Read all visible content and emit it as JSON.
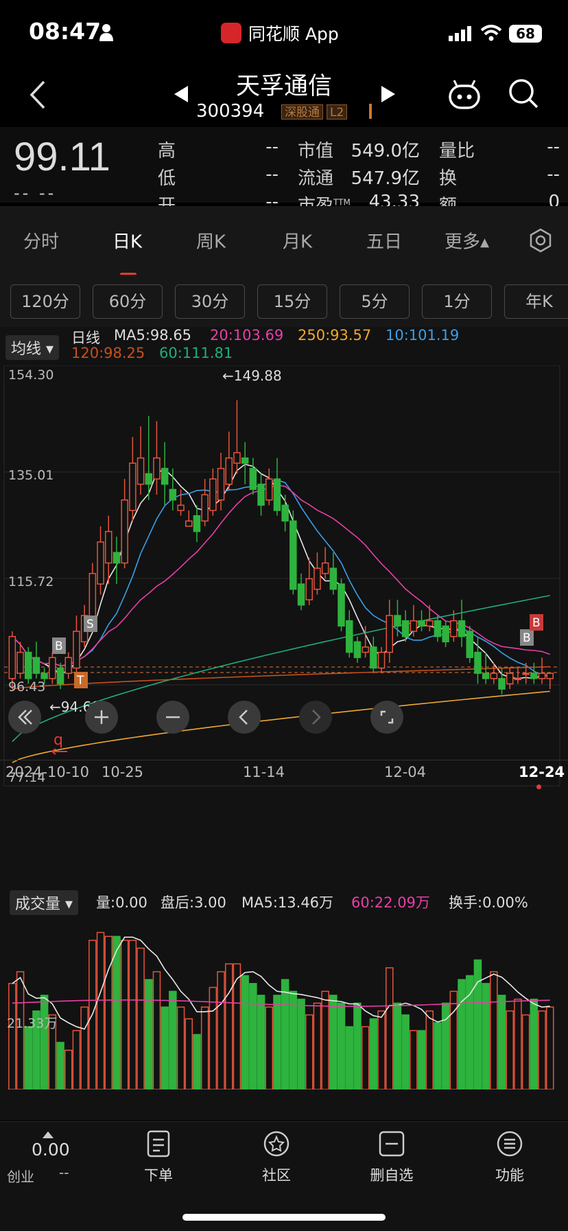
{
  "status_bar": {
    "time": "08:47",
    "app_name": "同花顺 App",
    "battery": "68"
  },
  "header": {
    "title": "天孚通信",
    "code": "300394",
    "tags": [
      "深股通",
      "L2"
    ]
  },
  "quote": {
    "price": "99.11",
    "change": "-- --",
    "fields": [
      {
        "label": "高",
        "value": "--"
      },
      {
        "label": "低",
        "value": "--"
      },
      {
        "label": "开",
        "value": "--"
      },
      {
        "label": "市值",
        "value": "549.0亿"
      },
      {
        "label": "流通",
        "value": "547.9亿"
      },
      {
        "label": "市盈",
        "sup": "TTM",
        "value": "43.33"
      },
      {
        "label": "量比",
        "value": "--"
      },
      {
        "label": "换",
        "value": "--"
      },
      {
        "label": "额",
        "value": "0"
      }
    ]
  },
  "tabs": [
    "分时",
    "日K",
    "周K",
    "月K",
    "五日",
    "更多▴"
  ],
  "active_tab": "日K",
  "periods": [
    "120分",
    "60分",
    "30分",
    "15分",
    "5分",
    "1分",
    "年K"
  ],
  "ma_legend": {
    "selector": "均线 ▾",
    "kind": "日线",
    "row1": [
      {
        "text": "MA5:98.65",
        "color": "#dddddd"
      },
      {
        "text": "20:103.69",
        "color": "#e83fa8"
      },
      {
        "text": "250:93.57",
        "color": "#f0a830"
      },
      {
        "text": "10:101.19",
        "color": "#3aa0e8"
      }
    ],
    "row2": [
      {
        "text": "120:98.25",
        "color": "#c8501a"
      },
      {
        "text": "60:111.81",
        "color": "#1fae7a"
      }
    ]
  },
  "chart_labels": {
    "y_ticks": [
      "154.30",
      "135.01",
      "115.72",
      "96.43",
      "77.14"
    ],
    "high_label": "←149.88",
    "low_label": "←94.60",
    "x_ticks": [
      "2024-10-10",
      "10-25",
      "11-14",
      "12-04",
      "12-24"
    ],
    "markers": [
      "B",
      "S",
      "T",
      "B",
      "B"
    ]
  },
  "volume_legend": {
    "selector": "成交量 ▾",
    "items": [
      {
        "text": "量:0.00",
        "color": "#dddddd"
      },
      {
        "text": "盘后:3.00",
        "color": "#dddddd"
      },
      {
        "text": "MA5:13.46万",
        "color": "#dddddd"
      },
      {
        "text": "60:22.09万",
        "color": "#e83fa8"
      },
      {
        "text": "换手:0.00%",
        "color": "#dddddd"
      }
    ],
    "y_label": "21.33万"
  },
  "chart_data": {
    "type": "candlestick",
    "ylim": [
      77.14,
      154.3
    ],
    "candles": [
      [
        96,
        104,
        94,
        105
      ],
      [
        97,
        101,
        96,
        103
      ],
      [
        101,
        96,
        95,
        102
      ],
      [
        100,
        97,
        96,
        103
      ],
      [
        97,
        96,
        95,
        98
      ],
      [
        96,
        100,
        95,
        101
      ],
      [
        98,
        95,
        94,
        99
      ],
      [
        97,
        100,
        96,
        101
      ],
      [
        98,
        105,
        97,
        108
      ],
      [
        103,
        108,
        102,
        110
      ],
      [
        106,
        116,
        105,
        118
      ],
      [
        114,
        122,
        112,
        125
      ],
      [
        118,
        124,
        114,
        127
      ],
      [
        120,
        118,
        114,
        123
      ],
      [
        118,
        130,
        117,
        134
      ],
      [
        128,
        137,
        126,
        142
      ],
      [
        133,
        138,
        131,
        144
      ],
      [
        135,
        133,
        130,
        146
      ],
      [
        134,
        138,
        131,
        145
      ],
      [
        136,
        133,
        129,
        141
      ],
      [
        132,
        130,
        128,
        136
      ],
      [
        128,
        129,
        127,
        132
      ],
      [
        125,
        126,
        125,
        128
      ],
      [
        127,
        124,
        122,
        129
      ],
      [
        126,
        131,
        125,
        134
      ],
      [
        128,
        134,
        127,
        136
      ],
      [
        130,
        136,
        128,
        139
      ],
      [
        133,
        138,
        132,
        143
      ],
      [
        137,
        139,
        135,
        149
      ],
      [
        138,
        137,
        133,
        141
      ],
      [
        136,
        132,
        131,
        138
      ],
      [
        133,
        129,
        127,
        135
      ],
      [
        130,
        134,
        129,
        136
      ],
      [
        134,
        128,
        127,
        138
      ],
      [
        129,
        126,
        124,
        131
      ],
      [
        126,
        113,
        112,
        128
      ],
      [
        114,
        110,
        109,
        116
      ],
      [
        111,
        115,
        110,
        119
      ],
      [
        113,
        117,
        112,
        120
      ],
      [
        116,
        118,
        115,
        121
      ],
      [
        117,
        113,
        112,
        120
      ],
      [
        114,
        106,
        105,
        115
      ],
      [
        107,
        101,
        100,
        109
      ],
      [
        103,
        100,
        99,
        104
      ],
      [
        101,
        102,
        100,
        106
      ],
      [
        102,
        98,
        97,
        104
      ],
      [
        98,
        101,
        97,
        102
      ],
      [
        101,
        108,
        99,
        111
      ],
      [
        108,
        106,
        104,
        111
      ],
      [
        107,
        104,
        103,
        109
      ],
      [
        105,
        107,
        104,
        110
      ],
      [
        107,
        106,
        105,
        109
      ],
      [
        106,
        107,
        105,
        110
      ],
      [
        107,
        104,
        103,
        108
      ],
      [
        106,
        103,
        102,
        107
      ],
      [
        104,
        107,
        103,
        109
      ],
      [
        107,
        104,
        102,
        111
      ],
      [
        105,
        100,
        99,
        106
      ],
      [
        101,
        97,
        95,
        104
      ],
      [
        97,
        96,
        95,
        101
      ],
      [
        96,
        97,
        95,
        99
      ],
      [
        96,
        94,
        93,
        98
      ],
      [
        95,
        97,
        94,
        98
      ],
      [
        96,
        96,
        95,
        98
      ],
      [
        97,
        97,
        95,
        99
      ],
      [
        97,
        96,
        95,
        99
      ],
      [
        96,
        97,
        95,
        100
      ],
      [
        96,
        97,
        94,
        97
      ]
    ],
    "volumes": [
      27,
      30,
      16,
      20,
      24,
      19,
      12,
      10,
      15,
      21,
      38,
      40,
      39,
      39,
      38,
      38,
      36,
      28,
      30,
      21,
      25,
      21,
      18,
      14,
      21,
      26,
      30,
      32,
      32,
      29,
      27,
      24,
      21,
      24,
      28,
      25,
      23,
      19,
      22,
      25,
      24,
      22,
      16,
      22,
      16,
      18,
      20,
      31,
      22,
      19,
      15,
      15,
      20,
      17,
      22,
      25,
      28,
      29,
      33,
      27,
      30,
      24,
      20,
      23,
      19,
      23,
      20,
      21
    ]
  }
}
